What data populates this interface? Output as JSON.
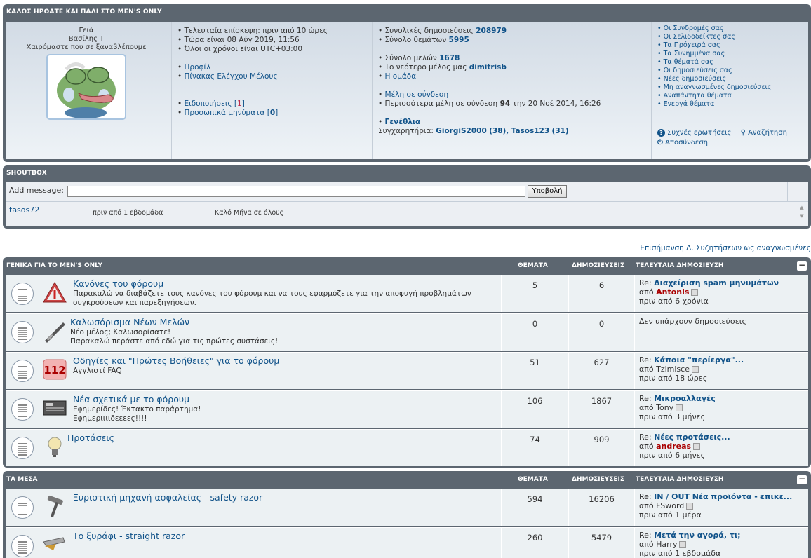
{
  "welcome": {
    "title": "ΚΑΛΩΣ ΗΡΘΑΤΕ ΚΑΙ ΠΑΛΙ ΣΤΟ MEN'S ONLY",
    "greet": "Γειά",
    "user": "Βασίλης Τ",
    "tagline": "Χαιρόμαστε που σε ξαναβλέπουμε",
    "last_visit": "• Τελευταία επίσκεψη: πριν από 10 ώρες",
    "now": "• Τώρα είναι 08 Αύγ 2019, 11:56",
    "tz": "• Όλοι οι χρόνοι είναι UTC+03:00",
    "profile": "Προφίλ",
    "ucp": "Πίνακας Ελέγχου Μέλους",
    "notif_label": "Ειδοποιήσεις [",
    "notif_count": "1",
    "pm_label": "Προσωπικά μηνύματα [",
    "pm_count": "0",
    "close_bracket": "]",
    "total_posts_label": "Συνολικές δημοσιεύσεις",
    "total_posts": "208979",
    "total_topics_label": "Σύνολο θεμάτων",
    "total_topics": "5995",
    "total_members_label": "Σύνολο μελών",
    "total_members": "1678",
    "newest_label": "Το νεότερο μέλος μας",
    "newest": "dimitrisb",
    "team": "Η ομάδα",
    "online": "Μέλη σε σύνδεση",
    "most_online_a": "Περισσότερα μέλη σε σύνδεση",
    "most_online_n": "94",
    "most_online_b": "την 20 Νοέ 2014, 16:26",
    "birthdays": "Γενέθλια",
    "congrats": "Συγχαρητήρια:",
    "bday1": "GiorgiS2000",
    "bday1_age": "(38),",
    "bday2": "Tasos123",
    "bday2_age": "(31)",
    "links": [
      "Οι Συνδρομές σας",
      "Οι Σελιδοδείκτες σας",
      "Τα Πρόχειρά σας",
      "Τα Συνημμένα σας",
      "Τα θέματά σας",
      "Οι δημοσιεύσεις σας",
      "Νέες δημοσιεύσεις",
      "Μη αναγνωσμένες δημοσιεύσεις",
      "Αναπάντητα θέματα",
      "Ενεργά θέματα"
    ],
    "faq": "Συχνές ερωτήσεις",
    "search": "Αναζήτηση",
    "logout": "Αποσύνδεση"
  },
  "shoutbox": {
    "title": "SHOUTBOX",
    "add_label": "Add message:",
    "submit": "Υποβολή",
    "msg_user": "tasos72",
    "msg_time": "πριν από 1 εβδομάδα",
    "msg_text": "Καλό Μήνα σε όλους"
  },
  "mark_read": "Επισήμανση Δ. Συζητήσεων ως αναγνωσμένες",
  "col_topics": "ΘΕΜΑΤΑ",
  "col_posts": "ΔΗΜΟΣΙΕΥΣΕΙΣ",
  "col_last": "ΤΕΛΕΥΤΑΙΑ ΔΗΜΟΣΙΕΥΣΗ",
  "cat1": {
    "title": "ΓΕΝΙΚΑ ΓΙΑ ΤΟ MEN'S ONLY",
    "forums": [
      {
        "title": "Κανόνες του φόρουμ",
        "desc": "Παρακαλώ να διαβάζετε τους κανόνες του φόρουμ και να τους εφαρμόζετε για την αποφυγή προβλημάτων συγκρούσεων και παρεξηγήσεων.",
        "topics": "5",
        "posts": "6",
        "last_title": "Διαχείριση spam μηνυμάτων",
        "by": "από",
        "last_author": "Antonis",
        "last_time": "πριν από 6 χρόνια"
      },
      {
        "title": "Καλωσόρισμα Νέων Μελών",
        "desc": "Νέο μέλος; Καλωσορίσατε!",
        "desc2": "Παρακαλώ περάστε από εδώ για τις πρώτες συστάσεις!",
        "topics": "0",
        "posts": "0",
        "no_posts": "Δεν υπάρχουν δημοσιεύσεις"
      },
      {
        "title": "Οδηγίες και \"Πρώτες Βοήθειες\" για το φόρουμ",
        "desc": "Αγγλιστί FAQ",
        "topics": "51",
        "posts": "627",
        "last_title": "Κάποια \"περίεργα\"...",
        "by": "από",
        "last_author": "Tzimisce",
        "last_time": "πριν από 18 ώρες"
      },
      {
        "title": "Νέα σχετικά με το φόρουμ",
        "desc": "Εφημερίδες! Έκτακτο παράρτημα!",
        "desc2": "Εφημεριιιιδεεεες!!!!",
        "topics": "106",
        "posts": "1867",
        "last_title": "Μικροαλλαγές",
        "by": "από",
        "last_author": "Tony",
        "last_time": "πριν από 3 μήνες"
      },
      {
        "title": "Προτάσεις",
        "topics": "74",
        "posts": "909",
        "last_title": "Νέες προτάσεις...",
        "by": "από",
        "last_author": "andreas",
        "last_time": "πριν από 6 μήνες"
      }
    ]
  },
  "cat2": {
    "title": "ΤΑ ΜΕΣΑ",
    "forums": [
      {
        "title": "Ξυριστική μηχανή ασφαλείας - safety razor",
        "topics": "594",
        "posts": "16206",
        "last_title": "IN / OUT Νέα προϊόντα - επικε...",
        "by": "από",
        "last_author": "FSword",
        "last_time": "πριν από 1 μέρα"
      },
      {
        "title": "Το ξυράφι - straight razor",
        "topics": "260",
        "posts": "5479",
        "last_title": "Μετά την αγορά, τι;",
        "by": "από",
        "last_author": "Harry",
        "last_time": "πριν από 1 εβδομάδα"
      }
    ]
  },
  "re": "Re:"
}
